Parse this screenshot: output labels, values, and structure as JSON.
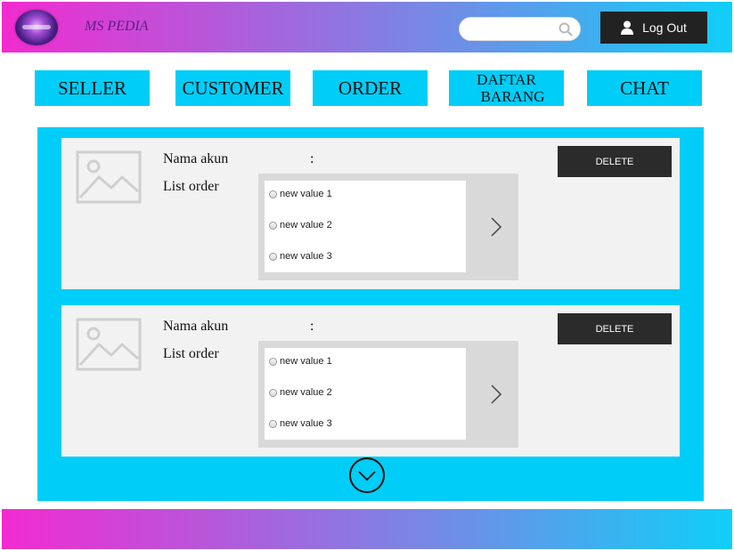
{
  "header": {
    "brand": "MS PEDIA",
    "search": {
      "value": "",
      "placeholder": ""
    },
    "logout_label": "Log Out"
  },
  "nav": {
    "items": [
      {
        "label": "SELLER"
      },
      {
        "label": "CUSTOMER"
      },
      {
        "label": "ORDER"
      },
      {
        "line1": "DAFTAR",
        "line2": "BARANG"
      },
      {
        "label": "CHAT"
      }
    ]
  },
  "cards": [
    {
      "name_label": "Nama akun",
      "colon": ":",
      "order_label": "List order",
      "orders": [
        "new value 1",
        "new value 2",
        "new value 3"
      ],
      "delete_label": "DELETE"
    },
    {
      "name_label": "Nama akun",
      "colon": ":",
      "order_label": "List order",
      "orders": [
        "new value 1",
        "new value 2",
        "new value 3"
      ],
      "delete_label": "DELETE"
    }
  ],
  "icons": {
    "search": "search-icon",
    "user": "user-icon",
    "image_placeholder": "image-placeholder-icon",
    "next": "chevron-right-icon",
    "more": "chevron-down-circle-icon"
  },
  "colors": {
    "gradient_start": "#f22bd0",
    "gradient_end": "#0fcff8",
    "accent": "#00cdf8",
    "dark_button": "#222222",
    "card_bg": "#f2f2f2"
  }
}
